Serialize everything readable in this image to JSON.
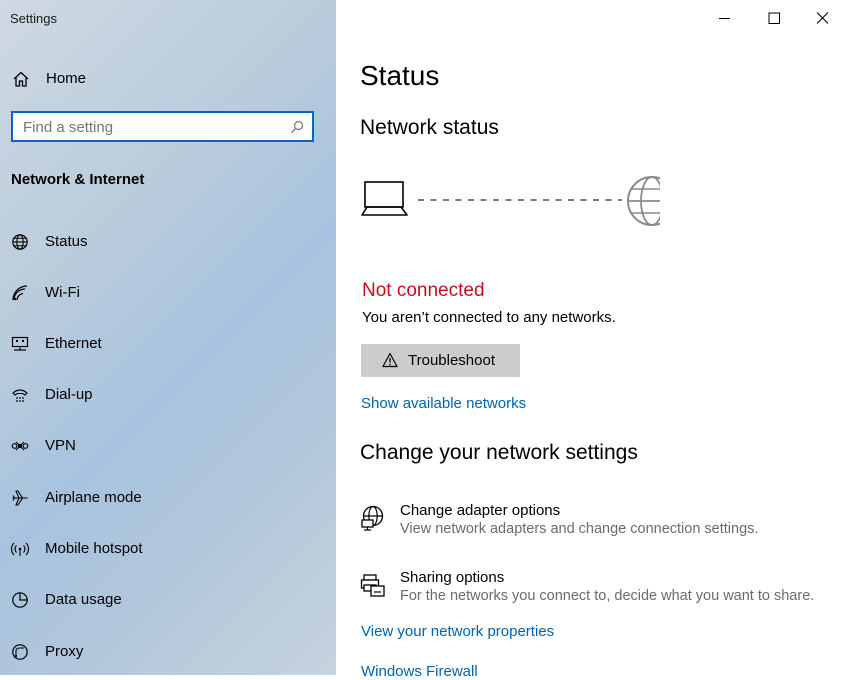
{
  "window": {
    "title": "Settings"
  },
  "sidebar": {
    "home_label": "Home",
    "search_placeholder": "Find a setting",
    "section_title": "Network & Internet",
    "items": [
      {
        "label": "Status",
        "icon": "globe-icon"
      },
      {
        "label": "Wi-Fi",
        "icon": "wifi-icon"
      },
      {
        "label": "Ethernet",
        "icon": "ethernet-icon"
      },
      {
        "label": "Dial-up",
        "icon": "dialup-icon"
      },
      {
        "label": "VPN",
        "icon": "vpn-icon"
      },
      {
        "label": "Airplane mode",
        "icon": "airplane-icon"
      },
      {
        "label": "Mobile hotspot",
        "icon": "hotspot-icon"
      },
      {
        "label": "Data usage",
        "icon": "data-usage-icon"
      },
      {
        "label": "Proxy",
        "icon": "proxy-icon"
      }
    ]
  },
  "main": {
    "title": "Status",
    "network_status_heading": "Network status",
    "connection_state": "Not connected",
    "connection_desc": "You aren’t connected to any networks.",
    "troubleshoot_label": "Troubleshoot",
    "show_networks_link": "Show available networks",
    "change_settings_heading": "Change your network settings",
    "options": [
      {
        "title": "Change adapter options",
        "desc": "View network adapters and change connection settings.",
        "icon": "adapter-icon"
      },
      {
        "title": "Sharing options",
        "desc": "For the networks you connect to, decide what you want to share.",
        "icon": "sharing-icon"
      }
    ],
    "properties_link": "View your network properties",
    "firewall_link": "Windows Firewall"
  },
  "colors": {
    "error": "#c50f1f",
    "link": "#0063b1",
    "search_border": "#0a64c8",
    "button_bg": "#cccccc"
  }
}
